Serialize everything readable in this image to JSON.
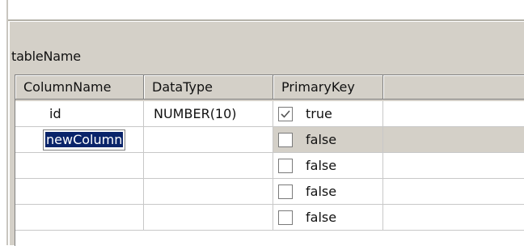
{
  "table": {
    "name": "tableName",
    "columns": [
      "ColumnName",
      "DataType",
      "PrimaryKey",
      ""
    ],
    "rows": [
      {
        "column_name": "id",
        "data_type": "NUMBER(10)",
        "primary_key": "true",
        "checked": true
      },
      {
        "column_name": "newColumn",
        "data_type": "",
        "primary_key": "false",
        "checked": false
      },
      {
        "column_name": "",
        "data_type": "",
        "primary_key": "false",
        "checked": false
      },
      {
        "column_name": "",
        "data_type": "",
        "primary_key": "false",
        "checked": false
      },
      {
        "column_name": "",
        "data_type": "",
        "primary_key": "false",
        "checked": false
      }
    ]
  },
  "colors": {
    "panel": "#d4d0c8",
    "selection": "#0a246a"
  },
  "icons": {
    "checked": "checkmark-icon"
  }
}
